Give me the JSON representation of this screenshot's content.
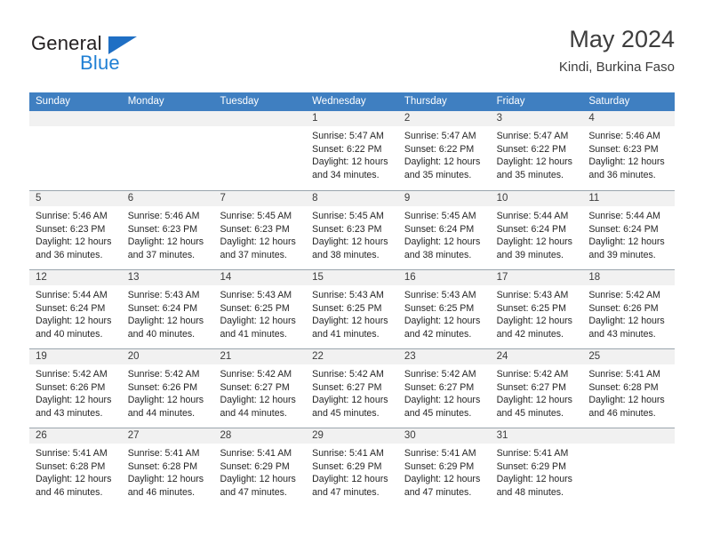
{
  "logo": {
    "word_top": "General",
    "word_bottom": "Blue",
    "triangle_color": "#1f6fc4",
    "blue_color": "#1f7fd4"
  },
  "header": {
    "title": "May 2024",
    "subtitle": "Kindi, Burkina Faso"
  },
  "theme": {
    "header_row_bg": "#3f7fc1",
    "day_number_bg": "#f1f1f1",
    "grid_line": "#9aa5ad"
  },
  "weekdays": [
    "Sunday",
    "Monday",
    "Tuesday",
    "Wednesday",
    "Thursday",
    "Friday",
    "Saturday"
  ],
  "weeks": [
    [
      {
        "day": "",
        "empty": true,
        "lines": []
      },
      {
        "day": "",
        "empty": true,
        "lines": []
      },
      {
        "day": "",
        "empty": true,
        "lines": []
      },
      {
        "day": "1",
        "empty": false,
        "lines": [
          "Sunrise: 5:47 AM",
          "Sunset: 6:22 PM",
          "Daylight: 12 hours",
          "and 34 minutes."
        ]
      },
      {
        "day": "2",
        "empty": false,
        "lines": [
          "Sunrise: 5:47 AM",
          "Sunset: 6:22 PM",
          "Daylight: 12 hours",
          "and 35 minutes."
        ]
      },
      {
        "day": "3",
        "empty": false,
        "lines": [
          "Sunrise: 5:47 AM",
          "Sunset: 6:22 PM",
          "Daylight: 12 hours",
          "and 35 minutes."
        ]
      },
      {
        "day": "4",
        "empty": false,
        "lines": [
          "Sunrise: 5:46 AM",
          "Sunset: 6:23 PM",
          "Daylight: 12 hours",
          "and 36 minutes."
        ]
      }
    ],
    [
      {
        "day": "5",
        "empty": false,
        "lines": [
          "Sunrise: 5:46 AM",
          "Sunset: 6:23 PM",
          "Daylight: 12 hours",
          "and 36 minutes."
        ]
      },
      {
        "day": "6",
        "empty": false,
        "lines": [
          "Sunrise: 5:46 AM",
          "Sunset: 6:23 PM",
          "Daylight: 12 hours",
          "and 37 minutes."
        ]
      },
      {
        "day": "7",
        "empty": false,
        "lines": [
          "Sunrise: 5:45 AM",
          "Sunset: 6:23 PM",
          "Daylight: 12 hours",
          "and 37 minutes."
        ]
      },
      {
        "day": "8",
        "empty": false,
        "lines": [
          "Sunrise: 5:45 AM",
          "Sunset: 6:23 PM",
          "Daylight: 12 hours",
          "and 38 minutes."
        ]
      },
      {
        "day": "9",
        "empty": false,
        "lines": [
          "Sunrise: 5:45 AM",
          "Sunset: 6:24 PM",
          "Daylight: 12 hours",
          "and 38 minutes."
        ]
      },
      {
        "day": "10",
        "empty": false,
        "lines": [
          "Sunrise: 5:44 AM",
          "Sunset: 6:24 PM",
          "Daylight: 12 hours",
          "and 39 minutes."
        ]
      },
      {
        "day": "11",
        "empty": false,
        "lines": [
          "Sunrise: 5:44 AM",
          "Sunset: 6:24 PM",
          "Daylight: 12 hours",
          "and 39 minutes."
        ]
      }
    ],
    [
      {
        "day": "12",
        "empty": false,
        "lines": [
          "Sunrise: 5:44 AM",
          "Sunset: 6:24 PM",
          "Daylight: 12 hours",
          "and 40 minutes."
        ]
      },
      {
        "day": "13",
        "empty": false,
        "lines": [
          "Sunrise: 5:43 AM",
          "Sunset: 6:24 PM",
          "Daylight: 12 hours",
          "and 40 minutes."
        ]
      },
      {
        "day": "14",
        "empty": false,
        "lines": [
          "Sunrise: 5:43 AM",
          "Sunset: 6:25 PM",
          "Daylight: 12 hours",
          "and 41 minutes."
        ]
      },
      {
        "day": "15",
        "empty": false,
        "lines": [
          "Sunrise: 5:43 AM",
          "Sunset: 6:25 PM",
          "Daylight: 12 hours",
          "and 41 minutes."
        ]
      },
      {
        "day": "16",
        "empty": false,
        "lines": [
          "Sunrise: 5:43 AM",
          "Sunset: 6:25 PM",
          "Daylight: 12 hours",
          "and 42 minutes."
        ]
      },
      {
        "day": "17",
        "empty": false,
        "lines": [
          "Sunrise: 5:43 AM",
          "Sunset: 6:25 PM",
          "Daylight: 12 hours",
          "and 42 minutes."
        ]
      },
      {
        "day": "18",
        "empty": false,
        "lines": [
          "Sunrise: 5:42 AM",
          "Sunset: 6:26 PM",
          "Daylight: 12 hours",
          "and 43 minutes."
        ]
      }
    ],
    [
      {
        "day": "19",
        "empty": false,
        "lines": [
          "Sunrise: 5:42 AM",
          "Sunset: 6:26 PM",
          "Daylight: 12 hours",
          "and 43 minutes."
        ]
      },
      {
        "day": "20",
        "empty": false,
        "lines": [
          "Sunrise: 5:42 AM",
          "Sunset: 6:26 PM",
          "Daylight: 12 hours",
          "and 44 minutes."
        ]
      },
      {
        "day": "21",
        "empty": false,
        "lines": [
          "Sunrise: 5:42 AM",
          "Sunset: 6:27 PM",
          "Daylight: 12 hours",
          "and 44 minutes."
        ]
      },
      {
        "day": "22",
        "empty": false,
        "lines": [
          "Sunrise: 5:42 AM",
          "Sunset: 6:27 PM",
          "Daylight: 12 hours",
          "and 45 minutes."
        ]
      },
      {
        "day": "23",
        "empty": false,
        "lines": [
          "Sunrise: 5:42 AM",
          "Sunset: 6:27 PM",
          "Daylight: 12 hours",
          "and 45 minutes."
        ]
      },
      {
        "day": "24",
        "empty": false,
        "lines": [
          "Sunrise: 5:42 AM",
          "Sunset: 6:27 PM",
          "Daylight: 12 hours",
          "and 45 minutes."
        ]
      },
      {
        "day": "25",
        "empty": false,
        "lines": [
          "Sunrise: 5:41 AM",
          "Sunset: 6:28 PM",
          "Daylight: 12 hours",
          "and 46 minutes."
        ]
      }
    ],
    [
      {
        "day": "26",
        "empty": false,
        "lines": [
          "Sunrise: 5:41 AM",
          "Sunset: 6:28 PM",
          "Daylight: 12 hours",
          "and 46 minutes."
        ]
      },
      {
        "day": "27",
        "empty": false,
        "lines": [
          "Sunrise: 5:41 AM",
          "Sunset: 6:28 PM",
          "Daylight: 12 hours",
          "and 46 minutes."
        ]
      },
      {
        "day": "28",
        "empty": false,
        "lines": [
          "Sunrise: 5:41 AM",
          "Sunset: 6:29 PM",
          "Daylight: 12 hours",
          "and 47 minutes."
        ]
      },
      {
        "day": "29",
        "empty": false,
        "lines": [
          "Sunrise: 5:41 AM",
          "Sunset: 6:29 PM",
          "Daylight: 12 hours",
          "and 47 minutes."
        ]
      },
      {
        "day": "30",
        "empty": false,
        "lines": [
          "Sunrise: 5:41 AM",
          "Sunset: 6:29 PM",
          "Daylight: 12 hours",
          "and 47 minutes."
        ]
      },
      {
        "day": "31",
        "empty": false,
        "lines": [
          "Sunrise: 5:41 AM",
          "Sunset: 6:29 PM",
          "Daylight: 12 hours",
          "and 48 minutes."
        ]
      },
      {
        "day": "",
        "empty": true,
        "lines": []
      }
    ]
  ]
}
